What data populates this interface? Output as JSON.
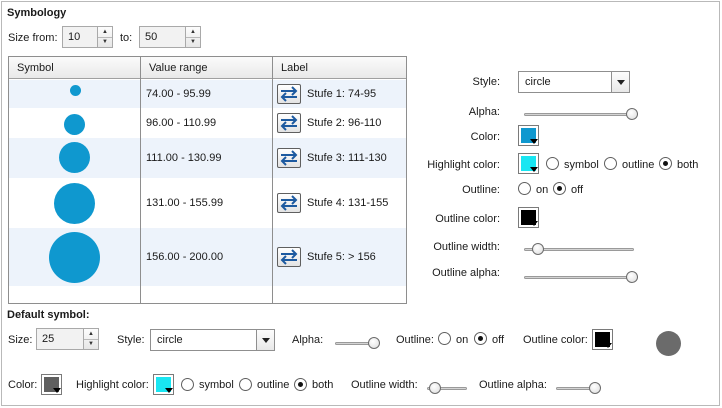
{
  "symbology": {
    "title": "Symbology",
    "size_from_label": "Size from:",
    "size_from_value": "10",
    "size_to_label": "to:",
    "size_to_value": "50"
  },
  "table": {
    "headers": [
      "Symbol",
      "Value range",
      "Label"
    ],
    "rows": [
      {
        "range": "74.00 - 95.99",
        "label": "Stufe 1: 74-95"
      },
      {
        "range": "96.00 - 110.99",
        "label": "Stufe 2: 96-110"
      },
      {
        "range": "111.00 - 130.99",
        "label": "Stufe 3: 111-130"
      },
      {
        "range": "131.00 - 155.99",
        "label": "Stufe 4: 131-155"
      },
      {
        "range": "156.00 - 200.00",
        "label": "Stufe 5: > 156"
      }
    ]
  },
  "right_panel": {
    "style_label": "Style:",
    "style_value": "circle",
    "alpha_label": "Alpha:",
    "alpha_level": 1.0,
    "color_label": "Color:",
    "color": "#0f98cf",
    "highlight_label": "Highlight color:",
    "highlight_color": "#19e6f2",
    "highlight_options": [
      "symbol",
      "outline",
      "both"
    ],
    "highlight_selected": "both",
    "outline_label": "Outline:",
    "outline_options": [
      "on",
      "off"
    ],
    "outline_selected": "off",
    "outline_color_label": "Outline color:",
    "outline_color": "#000000",
    "outline_width_label": "Outline width:",
    "outline_width_level": 0.1,
    "outline_alpha_label": "Outline alpha:",
    "outline_alpha_level": 1.0
  },
  "default_symbol": {
    "title": "Default symbol:",
    "size_label": "Size:",
    "size_value": "25",
    "style_label": "Style:",
    "style_value": "circle",
    "alpha_label": "Alpha:",
    "outline_label": "Outline:",
    "outline_options": [
      "on",
      "off"
    ],
    "outline_selected": "off",
    "outline_color_label": "Outline color:",
    "outline_color": "#000000",
    "preview_color": "#6b6b6b",
    "color_label": "Color:",
    "color": "#5f5f5f",
    "highlight_label": "Highlight color:",
    "highlight_color": "#19e6f2",
    "highlight_options": [
      "symbol",
      "outline",
      "both"
    ],
    "highlight_selected": "both",
    "outline_width_label": "Outline width:",
    "outline_alpha_label": "Outline alpha:"
  },
  "colors": {
    "symbol_blue": "#0f98cf",
    "row_alt": "#edf3fb",
    "swap_arrow": "#1d5aa0"
  }
}
